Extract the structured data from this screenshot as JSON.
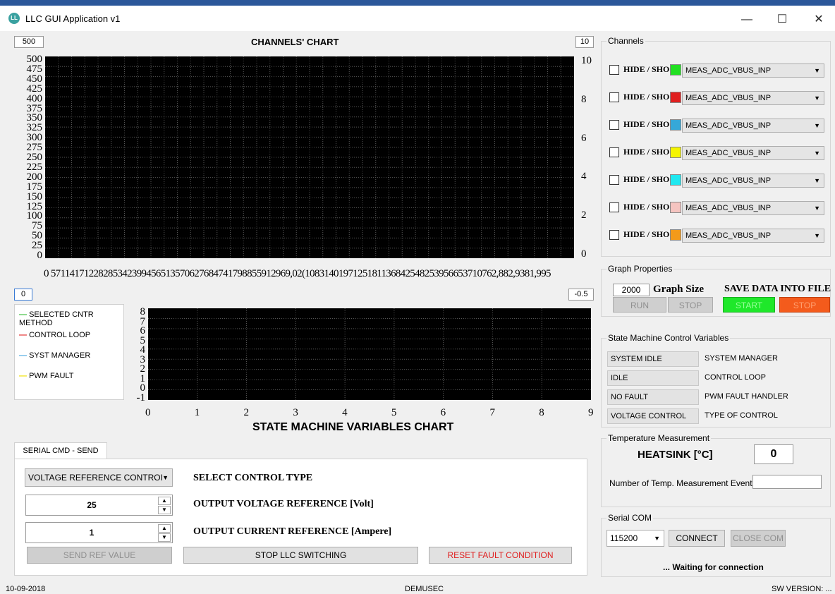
{
  "window": {
    "title": "LLC GUI Application v1",
    "icon": "llc-app-icon",
    "minimize": "—",
    "maximize": "☐",
    "close": "✕"
  },
  "top_chart": {
    "title": "CHANNELS' CHART",
    "left_max_box": "500",
    "right_max_box": "10",
    "left_axis_ticks": [
      "500",
      "475",
      "450",
      "425",
      "400",
      "375",
      "350",
      "325",
      "300",
      "275",
      "250",
      "225",
      "200",
      "175",
      "150",
      "125",
      "100",
      "75",
      "50",
      "25",
      "0"
    ],
    "right_axis_ticks": [
      "10",
      "8",
      "6",
      "4",
      "2",
      "0"
    ],
    "x_ticks_text": "0 57114171228285342399456513570627684741798855912969,02(1083140197125181136842548253956653710762,882,9381,995",
    "left_min_box": "0",
    "right_min_box": "-0.5"
  },
  "state_chart": {
    "title": "STATE MACHINE VARIABLES CHART",
    "legend": [
      {
        "label": "SELECTED CNTR METHOD",
        "color": "#3fbf3f"
      },
      {
        "label": "CONTROL LOOP",
        "color": "#e02020"
      },
      {
        "label": "SYST MANAGER",
        "color": "#4aa8e0"
      },
      {
        "label": "PWM FAULT",
        "color": "#f0e000"
      }
    ],
    "y_ticks": [
      "8",
      "7",
      "6",
      "5",
      "4",
      "3",
      "2",
      "1",
      "0",
      "-1"
    ],
    "x_ticks": [
      "0",
      "1",
      "2",
      "3",
      "4",
      "5",
      "6",
      "7",
      "8",
      "9"
    ]
  },
  "channels": {
    "group_title": "Channels",
    "items": [
      {
        "label": "HIDE / SHO",
        "color": "#22e022",
        "signal": "MEAS_ADC_VBUS_INP"
      },
      {
        "label": "HIDE / SHO",
        "color": "#e02020",
        "signal": "MEAS_ADC_VBUS_INP"
      },
      {
        "label": "HIDE / SHO",
        "color": "#36a8d8",
        "signal": "MEAS_ADC_VBUS_INP"
      },
      {
        "label": "HIDE / SHO",
        "color": "#f5f500",
        "signal": "MEAS_ADC_VBUS_INP"
      },
      {
        "label": "HIDE / SHO",
        "color": "#20e8f0",
        "signal": "MEAS_ADC_VBUS_INP"
      },
      {
        "label": "HIDE / SHO",
        "color": "#f5c4c0",
        "signal": "MEAS_ADC_VBUS_INP"
      },
      {
        "label": "HIDE / SHO",
        "color": "#f39a1a",
        "signal": "MEAS_ADC_VBUS_INP"
      }
    ]
  },
  "graph_props": {
    "group_title": "Graph Properties",
    "graph_size_value": "2000",
    "graph_size_label": "Graph Size",
    "save_label": "SAVE DATA INTO FILE",
    "run": "RUN",
    "stop": "STOP",
    "start_save": "START",
    "stop_save": "STOP"
  },
  "state_vars": {
    "group_title": "State Machine Control Variables",
    "rows": [
      {
        "value": "SYSTEM IDLE",
        "label": "SYSTEM MANAGER"
      },
      {
        "value": "IDLE",
        "label": "CONTROL LOOP"
      },
      {
        "value": "NO FAULT",
        "label": "PWM FAULT HANDLER"
      },
      {
        "value": "VOLTAGE CONTROL",
        "label": "TYPE OF CONTROL"
      }
    ]
  },
  "temperature": {
    "group_title": "Temperature Measurement",
    "heatsink_label": "HEATSINK [°C]",
    "heatsink_value": "0",
    "event_label": "Number of Temp. Measurement Event",
    "event_value": ""
  },
  "serial_com": {
    "group_title": "Serial COM",
    "baud": "115200",
    "connect": "CONNECT",
    "close_com": "CLOSE COM",
    "status": "... Waiting for connection"
  },
  "serial_cmd": {
    "tab": "SERIAL CMD - SEND",
    "control_type_value": "VOLTAGE REFERENCE CONTROI",
    "control_type_label": "SELECT CONTROL TYPE",
    "voltage_value": "25",
    "voltage_label": "OUTPUT VOLTAGE REFERENCE [Volt]",
    "current_value": "1",
    "current_label": "OUTPUT CURRENT REFERENCE [Ampere]",
    "send_ref": "SEND REF VALUE",
    "stop_switching": "STOP LLC SWITCHING",
    "reset_fault": "RESET FAULT CONDITION"
  },
  "status_bar": {
    "date": "10-09-2018",
    "center": "DEMUSEC",
    "version": "SW VERSION: ..."
  }
}
